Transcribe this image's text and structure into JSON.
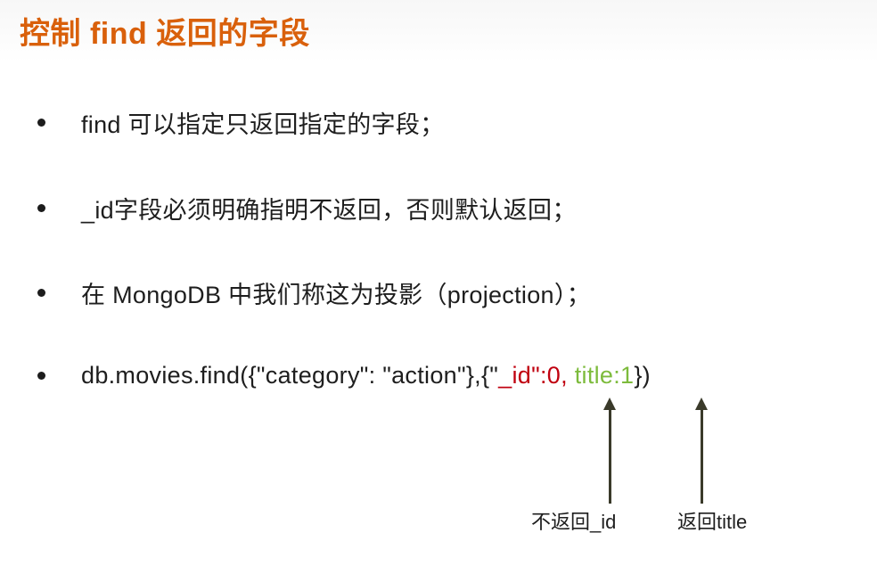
{
  "slide": {
    "title": "控制 find 返回的字段",
    "bullets": [
      "find 可以指定只返回指定的字段；",
      "_id字段必须明确指明不返回，否则默认返回；",
      "在 MongoDB 中我们称这为投影（projection）；"
    ],
    "code": {
      "prefix": "db.movies.find({\"category\": \"action\"},{\"",
      "id_part": "_id\":0,",
      "sep": " ",
      "title_part": "title:1",
      "suffix": "})"
    },
    "annotations": {
      "left_label": "不返回_id",
      "right_label": "返回title"
    },
    "colors": {
      "title": "#d9600b",
      "id_highlight": "#c0000f",
      "title_highlight": "#7dbb3c"
    }
  }
}
